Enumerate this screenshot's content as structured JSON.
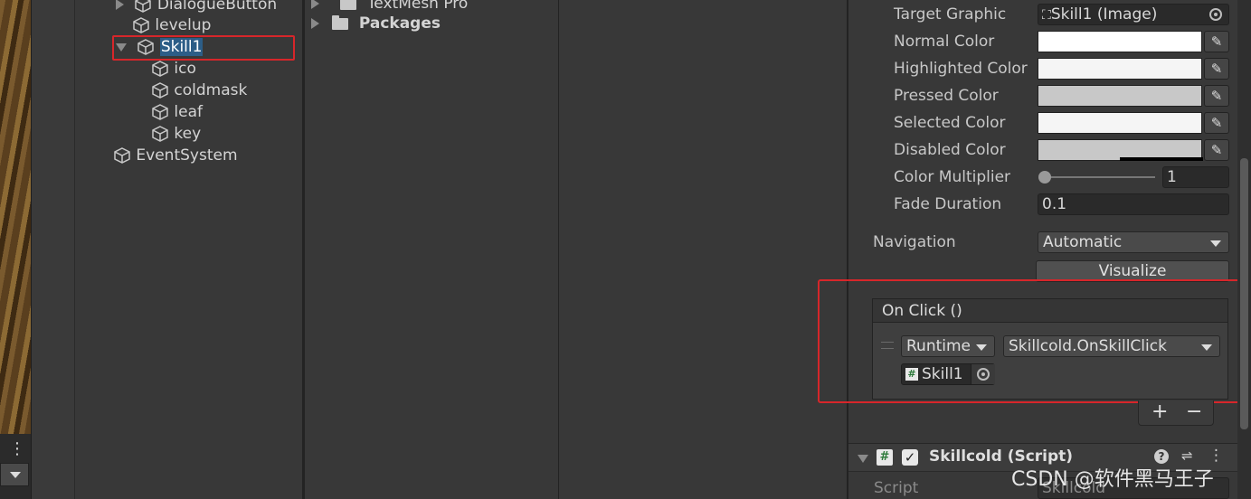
{
  "hierarchy": {
    "items": [
      {
        "label": "DialogueButton",
        "expand": "collapsed"
      },
      {
        "label": "levelup",
        "expand": "none"
      },
      {
        "label": "Skill1",
        "expand": "expanded",
        "selected": true
      },
      {
        "label": "ico",
        "expand": "none"
      },
      {
        "label": "coldmask",
        "expand": "none"
      },
      {
        "label": "leaf",
        "expand": "none"
      },
      {
        "label": "key",
        "expand": "none"
      },
      {
        "label": "EventSystem",
        "expand": "none"
      }
    ]
  },
  "project": {
    "folders": [
      {
        "label": "TextMesh Pro"
      },
      {
        "label": "Packages"
      }
    ]
  },
  "inspector": {
    "button": {
      "target_graphic_label": "Target Graphic",
      "target_graphic_value": "Skill1 (Image)",
      "normal_color_label": "Normal Color",
      "normal_color": "#ffffff",
      "highlighted_color_label": "Highlighted Color",
      "highlighted_color": "#f5f5f5",
      "pressed_color_label": "Pressed Color",
      "pressed_color": "#c8c8c8",
      "selected_color_label": "Selected Color",
      "selected_color": "#f5f5f5",
      "disabled_color_label": "Disabled Color",
      "disabled_color": "#c8c8c8",
      "color_multiplier_label": "Color Multiplier",
      "color_multiplier_value": "1",
      "fade_duration_label": "Fade Duration",
      "fade_duration_value": "0.1",
      "navigation_label": "Navigation",
      "navigation_value": "Automatic",
      "visualize_label": "Visualize"
    },
    "on_click": {
      "header": "On Click ()",
      "runtime_value": "Runtime",
      "function_value": "Skillcold.OnSkillClick",
      "object_value": "Skill1",
      "plus_label": "+",
      "minus_label": "−"
    },
    "component": {
      "title": "Skillcold (Script)",
      "enabled": true,
      "script_label": "Script",
      "script_value": "Skillcold"
    }
  },
  "watermark": "CSDN @软件黑马王子",
  "colors": {
    "selection": "#2c5d87",
    "highlight_box": "#d7262a"
  }
}
